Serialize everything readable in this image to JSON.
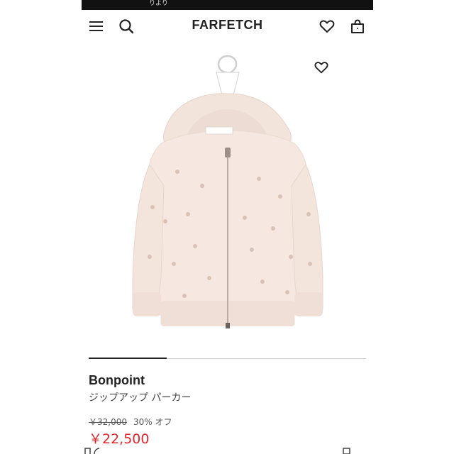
{
  "status_bar": {
    "text": "りより"
  },
  "header": {
    "logo": "FARFETCH",
    "menu_icon": "hamburger-menu-icon",
    "search_icon": "search-icon",
    "wishlist_icon": "heart-outline-icon",
    "bag_icon": "shopping-bag-icon"
  },
  "product": {
    "image_alt": "hoodie product image",
    "wishlist_icon": "heart-outline-icon",
    "brand": "Bonpoint",
    "name": "ジップアップ パーカー",
    "original_price": "￥32,000",
    "discount": "30% オフ",
    "sale_price": "￥22,500"
  },
  "colors": {
    "sale_price": "#e2262d",
    "garment": "#f5e8e0",
    "text": "#222222"
  }
}
